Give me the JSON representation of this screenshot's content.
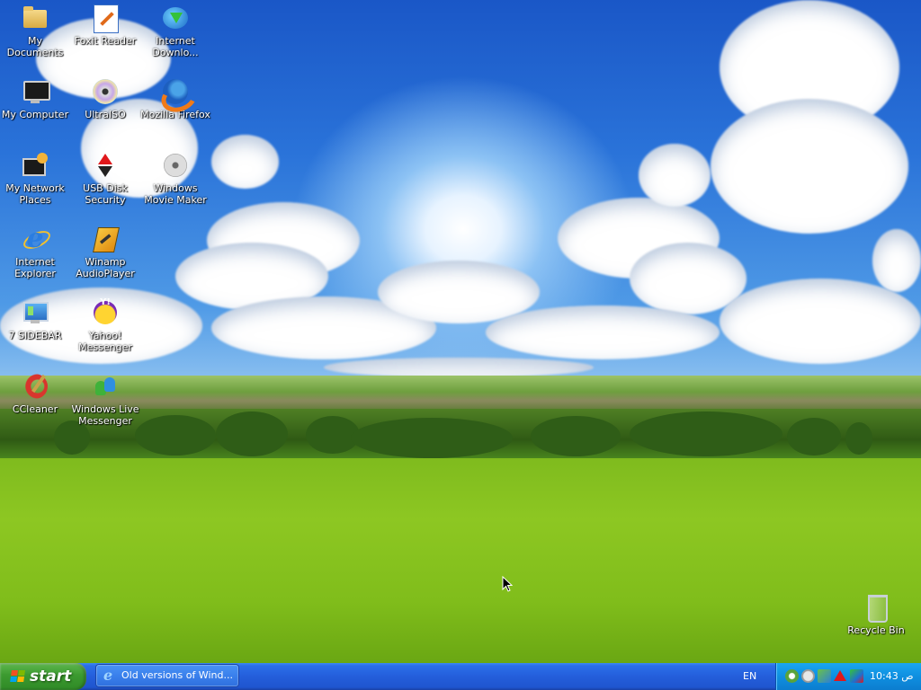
{
  "desktop": {
    "icons": [
      {
        "label": "My Documents",
        "icon": "folder-icon"
      },
      {
        "label": "Foxit Reader",
        "icon": "pdf-reader-icon"
      },
      {
        "label": "Internet Downlo...",
        "icon": "download-manager-icon"
      },
      {
        "label": "My Computer",
        "icon": "computer-icon"
      },
      {
        "label": "UltraISO",
        "icon": "disc-icon"
      },
      {
        "label": "Mozilla Firefox",
        "icon": "firefox-icon"
      },
      {
        "label": "My Network Places",
        "icon": "network-icon"
      },
      {
        "label": "USB Disk Security",
        "icon": "usb-security-icon"
      },
      {
        "label": "Windows Movie Maker",
        "icon": "film-reel-icon"
      },
      {
        "label": "Internet Explorer",
        "icon": "internet-explorer-icon"
      },
      {
        "label": "Winamp AudioPlayer",
        "icon": "winamp-icon"
      },
      {
        "label": "7 SIDEBAR",
        "icon": "sidebar-icon"
      },
      {
        "label": "Yahoo! Messenger",
        "icon": "yahoo-messenger-icon"
      },
      {
        "label": "CCleaner",
        "icon": "ccleaner-icon"
      },
      {
        "label": "Windows Live Messenger",
        "icon": "live-messenger-icon"
      },
      {
        "label": "Recycle Bin",
        "icon": "recycle-bin-icon"
      }
    ]
  },
  "taskbar": {
    "start_label": "start",
    "task": {
      "label": "Old versions of Wind...",
      "icon": "internet-explorer-icon"
    },
    "language": "EN",
    "clock": "10:43 ص",
    "tray_icons": [
      "utorrent-icon",
      "messenger-status-icon",
      "network-icon",
      "usb-security-icon",
      "wifi-icon"
    ]
  },
  "colors": {
    "taskbar_blue": "#245edb",
    "start_green": "#3c9a30",
    "tray_blue": "#0f8fe0"
  }
}
